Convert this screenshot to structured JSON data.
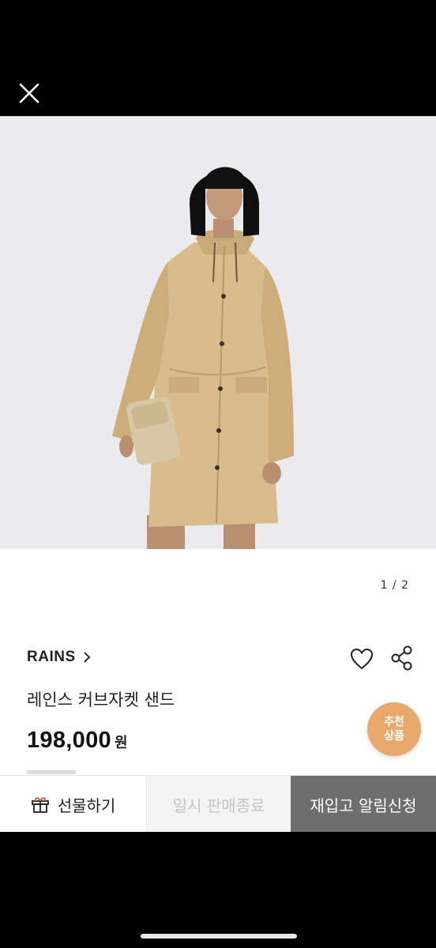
{
  "header": {
    "close_icon": "close-icon"
  },
  "gallery": {
    "indicator": "1 / 2",
    "image_alt": "model wearing beige hooded rain jacket holding a beige bag"
  },
  "product": {
    "brand": "RAINS",
    "title": "레인스 커브자켓 샌드",
    "price": "198,000",
    "currency": "원"
  },
  "actions": {
    "like_icon": "heart-icon",
    "share_icon": "share-icon"
  },
  "badge": {
    "line1": "추천",
    "line2": "상품",
    "color": "#e9a96e"
  },
  "bottom_bar": {
    "gift_label": "선물하기",
    "soldout_label": "일시 판매종료",
    "restock_label": "재입고 알림신청"
  },
  "colors": {
    "restock_bg": "#6e6e6e",
    "soldout_text": "#c4c4c4"
  }
}
